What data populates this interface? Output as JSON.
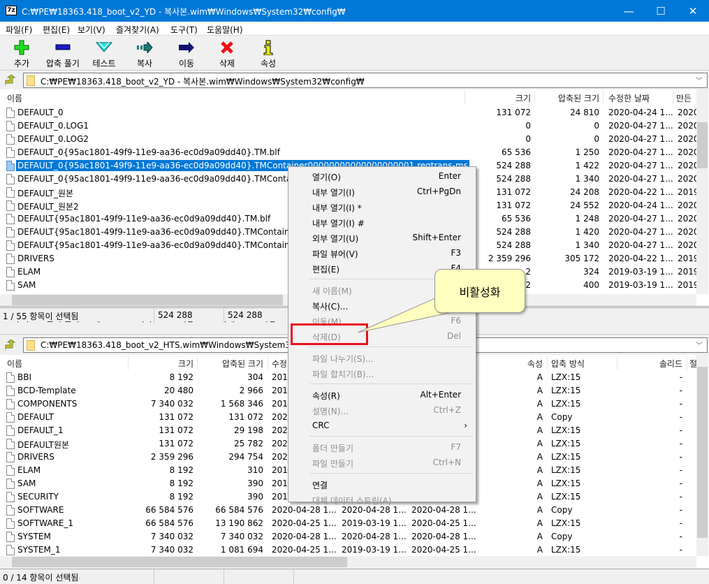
{
  "window": {
    "title": "C:₩PE₩18363.418_boot_v2_YD - 복사본.wim₩Windows₩System32₩config₩",
    "logo": "7z"
  },
  "menu": [
    "파일(F)",
    "편집(E)",
    "보기(V)",
    "즐겨찾기(A)",
    "도구(T)",
    "도움말(H)"
  ],
  "toolbar": [
    {
      "label": "추가",
      "icon": "plus-icon",
      "color": "#22dd22"
    },
    {
      "label": "압축 풀기",
      "icon": "minus-icon",
      "color": "#1a1acc"
    },
    {
      "label": "테스트",
      "icon": "check-chevron-icon",
      "color": "#33e0e0"
    },
    {
      "label": "복사",
      "icon": "copy-arrow-icon",
      "color": "#1a7a7a"
    },
    {
      "label": "이동",
      "icon": "move-arrow-icon",
      "color": "#101070"
    },
    {
      "label": "삭제",
      "icon": "delete-x-icon",
      "color": "#ee1111"
    },
    {
      "label": "속성",
      "icon": "info-icon",
      "color": "#e8e800"
    }
  ],
  "top": {
    "path": "C:₩PE₩18363.418_boot_v2_YD - 복사본.wim₩Windows₩System32₩config₩",
    "columns": [
      "이름",
      "크기",
      "압축된 크기",
      "수정한 날짜",
      "만든"
    ],
    "rows": [
      [
        "DEFAULT_0",
        "131 072",
        "24 810",
        "2020-04-24 1...",
        "2020"
      ],
      [
        "DEFAULT_0.LOG1",
        "0",
        "0",
        "2020-04-27 1...",
        "2020"
      ],
      [
        "DEFAULT_0.LOG2",
        "0",
        "0",
        "2020-04-27 1...",
        "2020"
      ],
      [
        "DEFAULT_0{95ac1801-49f9-11e9-aa36-ec0d9a09dd40}.TM.blf",
        "65 536",
        "1 250",
        "2020-04-27 1...",
        "2020"
      ],
      [
        "DEFAULT_0{95ac1801-49f9-11e9-aa36-ec0d9a09dd40}.TMContainer00000000000000000001.regtrans-ms",
        "524 288",
        "1 422",
        "2020-04-27 1...",
        "2020"
      ],
      [
        "DEFAULT_0{95ac1801-49f9-11e9-aa36-ec0d9a09dd40}.TMContainer00",
        "524 288",
        "1 340",
        "2020-04-27 1...",
        "2020"
      ],
      [
        "DEFAULT_원본",
        "131 072",
        "24 208",
        "2020-04-22 1...",
        "2019"
      ],
      [
        "DEFAULT_원본2",
        "131 072",
        "24 552",
        "2020-04-24 1...",
        "2020"
      ],
      [
        "DEFAULT{95ac1801-49f9-11e9-aa36-ec0d9a09dd40}.TM.blf",
        "65 536",
        "1 248",
        "2020-04-27 1...",
        "2020"
      ],
      [
        "DEFAULT{95ac1801-49f9-11e9-aa36-ec0d9a09dd40}.TMContainer0000",
        "524 288",
        "1 420",
        "2020-04-27 1...",
        "2020"
      ],
      [
        "DEFAULT{95ac1801-49f9-11e9-aa36-ec0d9a09dd40}.TMContainer0000",
        "524 288",
        "1 340",
        "2020-04-27 1...",
        "2020"
      ],
      [
        "DRIVERS",
        "2 359 296",
        "305 172",
        "2020-04-22 1...",
        "2019"
      ],
      [
        "ELAM",
        "2",
        "324",
        "2019-03-19 1...",
        "2019"
      ],
      [
        "SAM",
        "2",
        "400",
        "2019-03-19 1...",
        "2019"
      ]
    ],
    "selected_index": 4,
    "status": [
      "1 / 55 항목이 선택됨",
      "524 288",
      "524 288"
    ]
  },
  "bottom": {
    "path": "C:₩PE₩18363.418_boot_v2_HTS.wim₩Windows₩System32₩config₩",
    "columns": [
      "이름",
      "크기",
      "압축된 크기",
      "수정",
      "속성",
      "압축 방식",
      "솔리드",
      "절"
    ],
    "rows": [
      [
        "BBI",
        "8 192",
        "304",
        "201",
        "",
        "",
        "A",
        "LZX:15",
        "-"
      ],
      [
        "BCD-Template",
        "20 480",
        "2 966",
        "201",
        "",
        "",
        "A",
        "LZX:15",
        "-"
      ],
      [
        "COMPONENTS",
        "7 340 032",
        "1 568 346",
        "201",
        "",
        "",
        "A",
        "LZX:15",
        "-"
      ],
      [
        "DEFAULT",
        "131 072",
        "131 072",
        "202",
        "",
        "",
        "A",
        "Copy",
        "-"
      ],
      [
        "DEFAULT_1",
        "131 072",
        "29 198",
        "202",
        "",
        "",
        "A",
        "LZX:15",
        "-"
      ],
      [
        "DEFAULT원본",
        "131 072",
        "25 782",
        "202",
        "",
        "",
        "A",
        "LZX:15",
        "-"
      ],
      [
        "DRIVERS",
        "2 359 296",
        "294 754",
        "202",
        "",
        "",
        "A",
        "LZX:15",
        "-"
      ],
      [
        "ELAM",
        "8 192",
        "310",
        "201",
        "",
        "",
        "A",
        "LZX:15",
        "-"
      ],
      [
        "SAM",
        "8 192",
        "390",
        "201",
        "",
        "",
        "A",
        "LZX:15",
        "-"
      ],
      [
        "SECURITY",
        "8 192",
        "390",
        "201",
        "",
        "",
        "A",
        "LZX:15",
        "-"
      ],
      [
        "SOFTWARE",
        "66 584 576",
        "66 584 576",
        "2020-04-28 1...",
        "2020-04-28 1...",
        "2020-04-28 1...",
        "A",
        "Copy",
        "-"
      ],
      [
        "SOFTWARE_1",
        "66 584 576",
        "13 190 862",
        "2020-04-25 1...",
        "2019-03-19 1...",
        "2020-04-25 1...",
        "A",
        "LZX:15",
        "-"
      ],
      [
        "SYSTEM",
        "7 340 032",
        "7 340 032",
        "2020-04-28 1...",
        "2020-04-28 1...",
        "2020-04-28 1...",
        "A",
        "Copy",
        "-"
      ],
      [
        "SYSTEM_1",
        "7 340 032",
        "1 081 694",
        "2020-04-25 1...",
        "2019-03-19 1...",
        "2020-04-25 1...",
        "A",
        "LZX:15",
        "-"
      ]
    ],
    "status": [
      "0 / 14 항목이 선택됨"
    ]
  },
  "context_menu": [
    {
      "label": "열기(O)",
      "key": "Enter",
      "disabled": false
    },
    {
      "label": "내부 열기(I)",
      "key": "Ctrl+PgDn",
      "disabled": false
    },
    {
      "label": "내부 열기(I) *",
      "key": "",
      "disabled": false
    },
    {
      "label": "내부 열기(I) #",
      "key": "",
      "disabled": false
    },
    {
      "label": "외부 열기(U)",
      "key": "Shift+Enter",
      "disabled": false
    },
    {
      "label": "파일 뷰어(V)",
      "key": "F3",
      "disabled": false
    },
    {
      "label": "편집(E)",
      "key": "F4",
      "disabled": false
    },
    {
      "sep": true
    },
    {
      "label": "새 이름(M)",
      "key": "F2",
      "disabled": true
    },
    {
      "label": "복사(C)...",
      "key": "F5",
      "disabled": false
    },
    {
      "label": "이동(M)...",
      "key": "F6",
      "disabled": true
    },
    {
      "label": "삭제(D)",
      "key": "Del",
      "disabled": true
    },
    {
      "sep": true
    },
    {
      "label": "파일 나누기(S)...",
      "key": "",
      "disabled": true
    },
    {
      "label": "파일 합치기(B)...",
      "key": "",
      "disabled": true
    },
    {
      "sep": true
    },
    {
      "label": "속성(R)",
      "key": "Alt+Enter",
      "disabled": false
    },
    {
      "label": "설명(N)...",
      "key": "Ctrl+Z",
      "disabled": true
    },
    {
      "label": "CRC",
      "key": "›",
      "disabled": false
    },
    {
      "sep": true
    },
    {
      "label": "폴더 만들기",
      "key": "F7",
      "disabled": true
    },
    {
      "label": "파일 만들기",
      "key": "Ctrl+N",
      "disabled": true
    },
    {
      "sep": true
    },
    {
      "label": "연결",
      "key": "",
      "disabled": false
    },
    {
      "label": "대체 데이터 스트림(A)",
      "key": "",
      "disabled": true
    }
  ],
  "callout": {
    "text": "비활성화",
    "highlight_color": "#e8101c",
    "fill_color": "#ffffc0"
  }
}
